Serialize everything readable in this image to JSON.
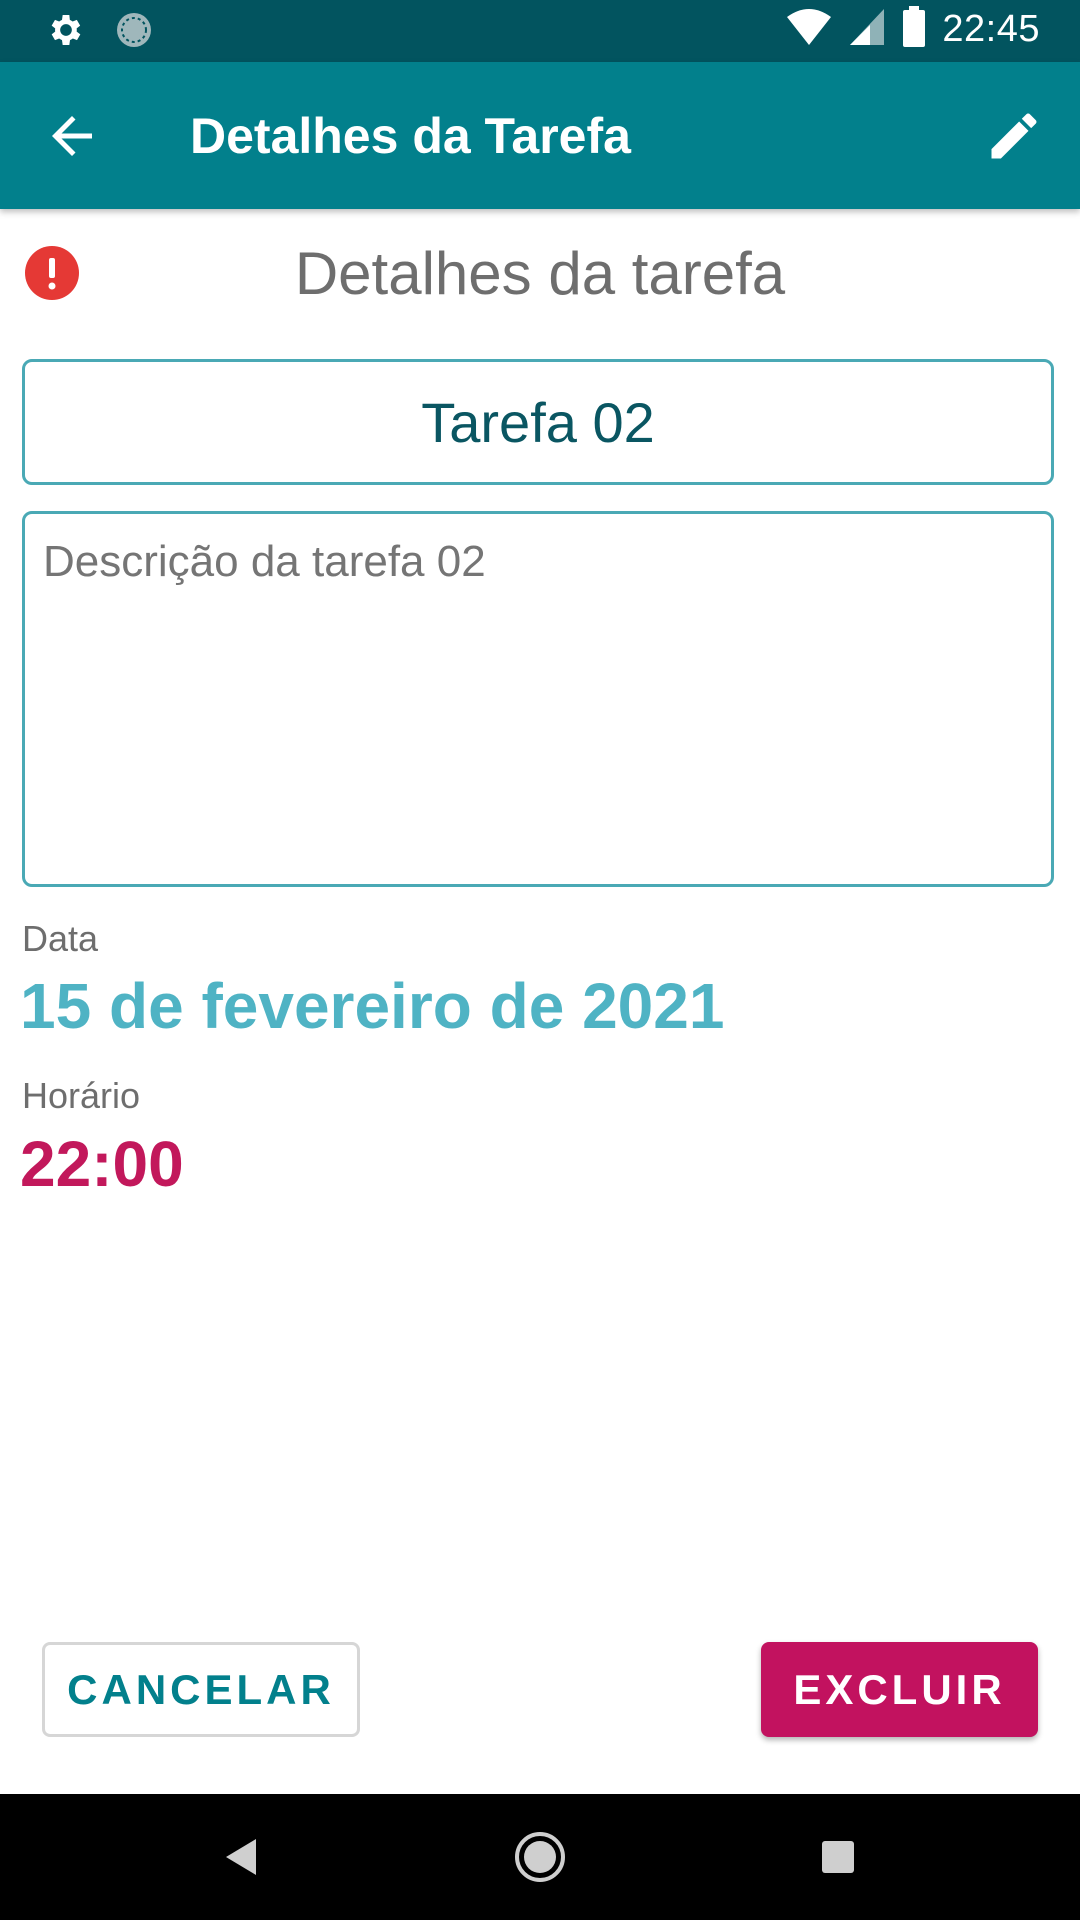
{
  "status_bar": {
    "time": "22:45",
    "icons": [
      "settings-icon",
      "sync-icon",
      "wifi-icon",
      "signal-icon",
      "battery-icon"
    ]
  },
  "app_bar": {
    "title": "Detalhes da Tarefa",
    "back_icon": "arrow-back-icon",
    "edit_icon": "pencil-icon"
  },
  "content": {
    "section_title": "Detalhes da tarefa",
    "task_title": "Tarefa 02",
    "description": "Descrição da tarefa 02",
    "date_label": "Data",
    "date_value": "15 de fevereiro de 2021",
    "time_label": "Horário",
    "time_value": "22:00"
  },
  "buttons": {
    "cancel": "CANCELAR",
    "delete": "EXCLUIR"
  },
  "colors": {
    "status_bar": "#02545f",
    "app_bar": "#02808c",
    "accent_teal": "#4fb3c4",
    "accent_magenta": "#c2185b",
    "alert_red": "#e53935"
  }
}
